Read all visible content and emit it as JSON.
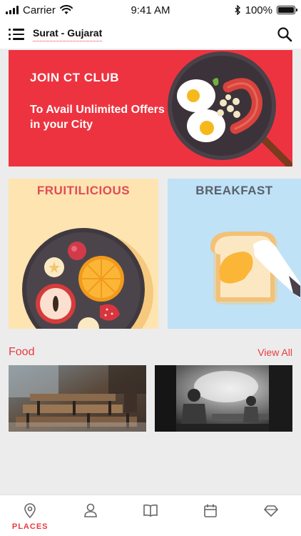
{
  "status_bar": {
    "carrier": "Carrier",
    "time": "9:41 AM",
    "battery": "100%",
    "battery_level": 1.0
  },
  "header": {
    "location": "Surat - Gujarat"
  },
  "banner": {
    "title": "JOIN CT CLUB",
    "subtitle": "To Avail Unlimited Offers in your City"
  },
  "categories": [
    {
      "title": "FRUITILICIOUS"
    },
    {
      "title": "BREAKFAST"
    }
  ],
  "food_section": {
    "title": "Food",
    "view_all": "View All"
  },
  "tabs": [
    {
      "icon": "map-pin-icon",
      "label": "PLACES",
      "active": true
    },
    {
      "icon": "user-icon",
      "label": "",
      "active": false
    },
    {
      "icon": "book-icon",
      "label": "",
      "active": false
    },
    {
      "icon": "calendar-icon",
      "label": "",
      "active": false
    },
    {
      "icon": "diamond-icon",
      "label": "",
      "active": false
    }
  ],
  "colors": {
    "accent": "#e63b41",
    "banner_bg": "#ee3340",
    "fruit_bg": "#fde4b0",
    "breakfast_bg": "#bfe2f6"
  }
}
